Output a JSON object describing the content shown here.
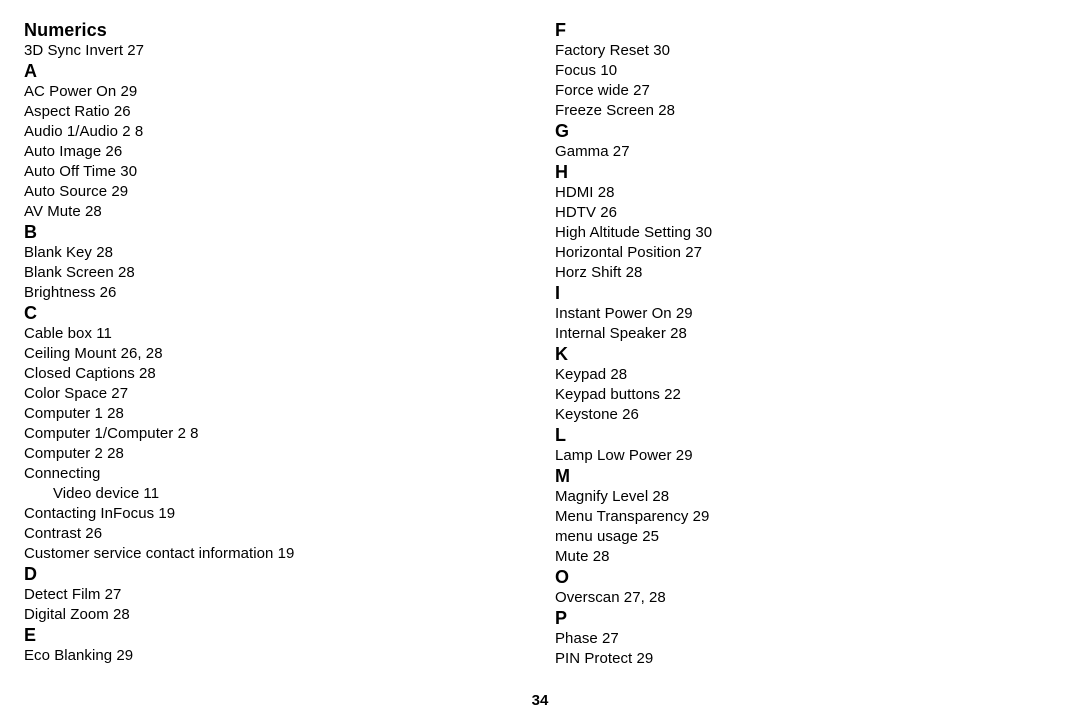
{
  "page": {
    "kind": "index",
    "page_number": "34",
    "text_color": "#000000",
    "background_color": "#ffffff"
  },
  "columns": [
    {
      "name": "left-column",
      "groups": [
        {
          "heading": "Numerics",
          "entries": [
            {
              "text": "3D Sync Invert 27",
              "sub": false
            }
          ]
        },
        {
          "heading": "A",
          "entries": [
            {
              "text": "AC Power On 29",
              "sub": false
            },
            {
              "text": "Aspect Ratio 26",
              "sub": false
            },
            {
              "text": "Audio 1/Audio 2 8",
              "sub": false
            },
            {
              "text": "Auto Image 26",
              "sub": false
            },
            {
              "text": "Auto Off Time 30",
              "sub": false
            },
            {
              "text": "Auto Source 29",
              "sub": false
            },
            {
              "text": "AV Mute 28",
              "sub": false
            }
          ]
        },
        {
          "heading": "B",
          "entries": [
            {
              "text": "Blank Key 28",
              "sub": false
            },
            {
              "text": "Blank Screen 28",
              "sub": false
            },
            {
              "text": "Brightness 26",
              "sub": false
            }
          ]
        },
        {
          "heading": "C",
          "entries": [
            {
              "text": "Cable box 11",
              "sub": false
            },
            {
              "text": "Ceiling Mount 26, 28",
              "sub": false
            },
            {
              "text": "Closed Captions 28",
              "sub": false
            },
            {
              "text": "Color Space 27",
              "sub": false
            },
            {
              "text": "Computer 1 28",
              "sub": false
            },
            {
              "text": "Computer 1/Computer 2 8",
              "sub": false
            },
            {
              "text": "Computer 2 28",
              "sub": false
            },
            {
              "text": "Connecting",
              "sub": false
            },
            {
              "text": "Video device 11",
              "sub": true
            },
            {
              "text": "Contacting InFocus 19",
              "sub": false
            },
            {
              "text": "Contrast 26",
              "sub": false
            },
            {
              "text": "Customer service contact information 19",
              "sub": false
            }
          ]
        },
        {
          "heading": "D",
          "entries": [
            {
              "text": "Detect Film 27",
              "sub": false
            },
            {
              "text": "Digital Zoom 28",
              "sub": false
            }
          ]
        },
        {
          "heading": "E",
          "entries": [
            {
              "text": "Eco Blanking 29",
              "sub": false
            }
          ]
        }
      ]
    },
    {
      "name": "right-column",
      "groups": [
        {
          "heading": "F",
          "entries": [
            {
              "text": "Factory Reset 30",
              "sub": false
            },
            {
              "text": "Focus 10",
              "sub": false
            },
            {
              "text": "Force wide 27",
              "sub": false
            },
            {
              "text": "Freeze Screen 28",
              "sub": false
            }
          ]
        },
        {
          "heading": "G",
          "entries": [
            {
              "text": "Gamma 27",
              "sub": false
            }
          ]
        },
        {
          "heading": "H",
          "entries": [
            {
              "text": "HDMI 28",
              "sub": false
            },
            {
              "text": "HDTV 26",
              "sub": false
            },
            {
              "text": "High Altitude Setting 30",
              "sub": false
            },
            {
              "text": "Horizontal Position 27",
              "sub": false
            },
            {
              "text": "Horz Shift 28",
              "sub": false
            }
          ]
        },
        {
          "heading": "I",
          "entries": [
            {
              "text": "Instant Power On 29",
              "sub": false
            },
            {
              "text": "Internal Speaker 28",
              "sub": false
            }
          ]
        },
        {
          "heading": "K",
          "entries": [
            {
              "text": "Keypad 28",
              "sub": false
            },
            {
              "text": "Keypad buttons 22",
              "sub": false
            },
            {
              "text": "Keystone 26",
              "sub": false
            }
          ]
        },
        {
          "heading": "L",
          "entries": [
            {
              "text": "Lamp Low Power 29",
              "sub": false
            }
          ]
        },
        {
          "heading": "M",
          "entries": [
            {
              "text": "Magnify Level 28",
              "sub": false
            },
            {
              "text": "Menu Transparency 29",
              "sub": false
            },
            {
              "text": "menu usage 25",
              "sub": false
            },
            {
              "text": "Mute 28",
              "sub": false
            }
          ]
        },
        {
          "heading": "O",
          "entries": [
            {
              "text": "Overscan 27, 28",
              "sub": false
            }
          ]
        },
        {
          "heading": "P",
          "entries": [
            {
              "text": "Phase 27",
              "sub": false
            },
            {
              "text": "PIN Protect 29",
              "sub": false
            }
          ]
        }
      ]
    }
  ]
}
